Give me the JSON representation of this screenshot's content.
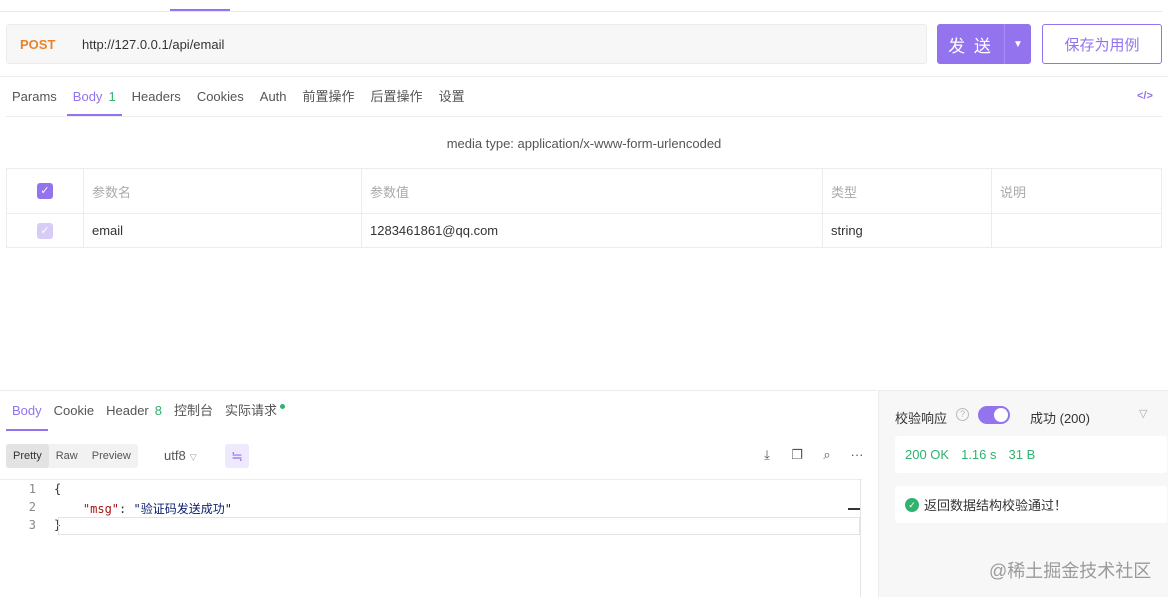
{
  "request": {
    "method": "POST",
    "url": "http://127.0.0.1/api/email",
    "send_label": "发 送",
    "save_label": "保存为用例"
  },
  "request_tabs": [
    {
      "label": "Params"
    },
    {
      "label": "Body",
      "count": "1"
    },
    {
      "label": "Headers"
    },
    {
      "label": "Cookies"
    },
    {
      "label": "Auth"
    },
    {
      "label": "前置操作"
    },
    {
      "label": "后置操作"
    },
    {
      "label": "设置"
    }
  ],
  "code_icon": "</>",
  "media_type": "media type: application/x-www-form-urlencoded",
  "params_table": {
    "headers": [
      "参数名",
      "参数值",
      "类型",
      "说明"
    ],
    "rows": [
      {
        "name": "email",
        "value": "1283461861@qq.com",
        "type": "string",
        "desc": ""
      }
    ]
  },
  "response_tabs": [
    {
      "label": "Body"
    },
    {
      "label": "Cookie"
    },
    {
      "label": "Header",
      "count": "8"
    },
    {
      "label": "控制台"
    },
    {
      "label": "实际请求"
    }
  ],
  "format_buttons": [
    "Pretty",
    "Raw",
    "Preview"
  ],
  "encoding": "utf8",
  "code_lines": [
    {
      "num": "1",
      "text": "{"
    },
    {
      "num": "2",
      "key": "\"msg\"",
      "sep": ": ",
      "value": "\"验证码发送成功\""
    },
    {
      "num": "3",
      "text": "}"
    }
  ],
  "validation": {
    "label": "校验响应",
    "status": "成功 (200)",
    "stats": [
      "200 OK",
      "1.16 s",
      "31 B"
    ],
    "result": "返回数据结构校验通过！"
  },
  "watermark": "@稀土掘金技术社区",
  "colors": {
    "accent": "#9373ee",
    "method": "#e9822a",
    "success": "#2fb36f"
  }
}
